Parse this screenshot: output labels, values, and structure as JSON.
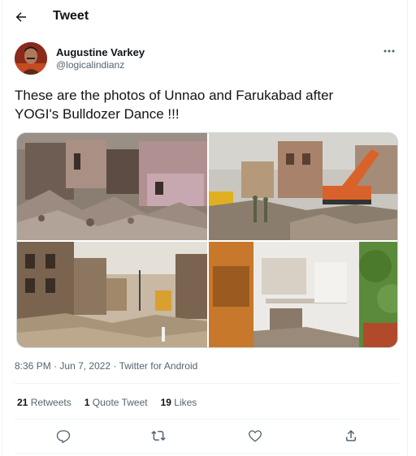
{
  "header": {
    "title": "Tweet",
    "back_icon": "arrow-left-icon"
  },
  "author": {
    "name": "Augustine Varkey",
    "handle": "@logicalindianz",
    "avatar_color": "#7a2a1c"
  },
  "tweet": {
    "text_line1": "These are the photos of Unnao and Farukabad after",
    "text_line2": "YOGI's Bulldozer Dance !!!",
    "photos": [
      {
        "name": "photo-1",
        "description_icon": "demolished-houses-photo"
      },
      {
        "name": "photo-2",
        "description_icon": "bulldozer-rubble-photo"
      },
      {
        "name": "photo-3",
        "description_icon": "demolished-street-photo"
      },
      {
        "name": "photo-4",
        "description_icon": "damaged-building-photo"
      }
    ],
    "time": "8:36 PM",
    "date": "Jun 7, 2022",
    "separator": "·",
    "source": "Twitter for Android"
  },
  "stats": {
    "retweets_count": "21",
    "retweets_label": "Retweets",
    "quotes_count": "1",
    "quotes_label": "Quote Tweet",
    "likes_count": "19",
    "likes_label": "Likes"
  },
  "actions": [
    "reply-icon",
    "retweet-icon",
    "like-icon",
    "share-icon"
  ],
  "colors": {
    "text": "#0f1419",
    "secondary": "#536471",
    "border": "#eff3f4",
    "accent": "#1d9bf0"
  }
}
